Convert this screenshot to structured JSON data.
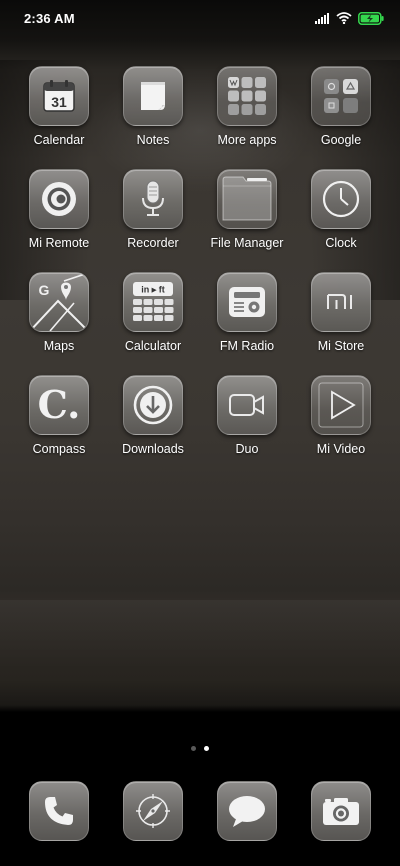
{
  "status_bar": {
    "time": "2:36 AM"
  },
  "apps": [
    {
      "label": "Calendar",
      "icon": "calendar-icon",
      "badge_text": "31"
    },
    {
      "label": "Notes",
      "icon": "notes-icon"
    },
    {
      "label": "More apps",
      "icon": "folder-icon"
    },
    {
      "label": "Google",
      "icon": "folder-icon"
    },
    {
      "label": "Mi Remote",
      "icon": "remote-icon"
    },
    {
      "label": "Recorder",
      "icon": "microphone-icon"
    },
    {
      "label": "File Manager",
      "icon": "file-folder-icon"
    },
    {
      "label": "Clock",
      "icon": "clock-icon"
    },
    {
      "label": "Maps",
      "icon": "map-icon"
    },
    {
      "label": "Calculator",
      "icon": "calculator-icon",
      "badge_text": "in ▸ ft"
    },
    {
      "label": "FM Radio",
      "icon": "radio-icon"
    },
    {
      "label": "Mi Store",
      "icon": "mi-store-icon",
      "badge_text": "mi"
    },
    {
      "label": "Compass",
      "icon": "compass-letter-icon",
      "badge_text": "C."
    },
    {
      "label": "Downloads",
      "icon": "download-icon"
    },
    {
      "label": "Duo",
      "icon": "video-camera-icon"
    },
    {
      "label": "Mi Video",
      "icon": "play-icon"
    }
  ],
  "page_indicator": {
    "pages": 2,
    "current": 2
  },
  "dock": [
    {
      "name": "Phone",
      "icon": "phone-icon"
    },
    {
      "name": "Browser",
      "icon": "compass-icon"
    },
    {
      "name": "Messaging",
      "icon": "message-bubble-icon"
    },
    {
      "name": "Camera",
      "icon": "camera-icon"
    }
  ],
  "colors": {
    "battery_fill": "#35d74e",
    "icon_tile_top": "#969492",
    "icon_tile_bottom": "#5c5a57"
  }
}
